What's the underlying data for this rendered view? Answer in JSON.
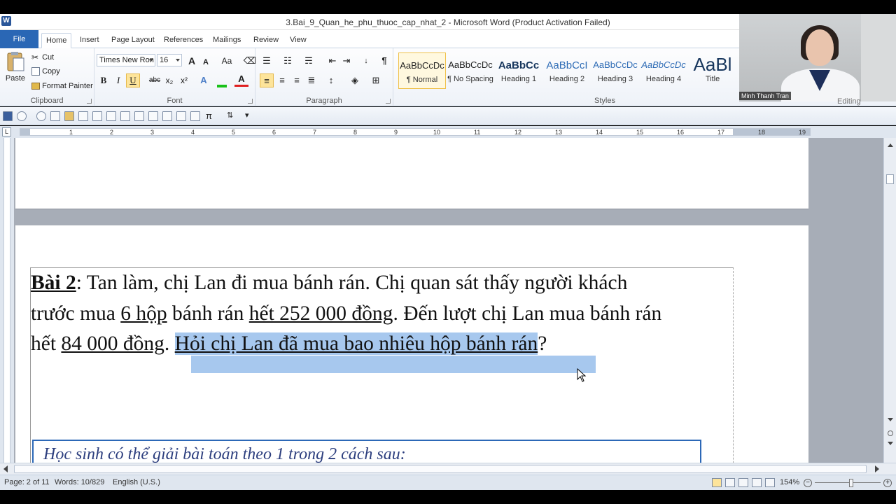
{
  "window": {
    "title": "3.Bai_9_Quan_he_phu_thuoc_cap_nhat_2 - Microsoft Word (Product Activation Failed)",
    "app_icon": "W"
  },
  "tabs": [
    "File",
    "Home",
    "Insert",
    "Page Layout",
    "References",
    "Mailings",
    "Review",
    "View"
  ],
  "ribbon": {
    "clipboard": {
      "label": "Clipboard",
      "paste": "Paste",
      "cut": "Cut",
      "copy": "Copy",
      "format_painter": "Format Painter"
    },
    "font": {
      "label": "Font",
      "font_name": "Times New Ron",
      "font_size": "16",
      "bold": "B",
      "italic": "I",
      "underline": "U",
      "strike": "abc",
      "subscript": "x₂",
      "superscript": "x²",
      "change_case": "Aa",
      "grow": "A",
      "shrink": "A"
    },
    "paragraph": {
      "label": "Paragraph"
    },
    "styles": {
      "label": "Styles",
      "items": [
        {
          "sample": "AaBbCcDc",
          "name": "¶ Normal"
        },
        {
          "sample": "AaBbCcDc",
          "name": "¶ No Spacing"
        },
        {
          "sample": "AaBbCc",
          "name": "Heading 1"
        },
        {
          "sample": "AaBbCcI",
          "name": "Heading 2"
        },
        {
          "sample": "AaBbCcDc",
          "name": "Heading 3"
        },
        {
          "sample": "AaBbCcDc",
          "name": "Heading 4"
        },
        {
          "sample": "AaBl",
          "name": "Title"
        }
      ]
    },
    "editing": {
      "label": "Editing"
    }
  },
  "ruler": {
    "tab_stop": "L",
    "numbers": [
      "2",
      "1",
      "1",
      "2",
      "3",
      "4",
      "5",
      "6",
      "7",
      "8",
      "9",
      "10",
      "11",
      "12",
      "13",
      "14",
      "15",
      "16",
      "17",
      "18",
      "19"
    ]
  },
  "document": {
    "line1": {
      "title": "Bài 2",
      "text": ": Tan làm, chị Lan đi mua bánh rán. Chị quan sát thấy người khách"
    },
    "line2": {
      "t1": "trước mua ",
      "u1": "6 hộp",
      "t2": " bánh rán ",
      "u2": "hết 252 000 đồng",
      "t3": ". Đến lượt chị Lan mua bánh rán"
    },
    "line3": {
      "t1": "hết ",
      "u1": "84 000 đồng",
      "t2": ". ",
      "selected": "Hỏi chị Lan đã mua bao nhiêu hộp bánh rán",
      "t3": "?"
    },
    "hint": "Học sinh có thể giải bài toán theo 1 trong 2 cách sau:"
  },
  "statusbar": {
    "page": "Page: 2 of 11",
    "words": "Words: 10/829",
    "language": "English (U.S.)",
    "zoom": "154%"
  },
  "webcam": {
    "name": "Minh Thanh Tran"
  },
  "colors": {
    "accent": "#2a67b5",
    "selection": "#a7c8ee",
    "ribbon_bg": "#eef2f8"
  }
}
